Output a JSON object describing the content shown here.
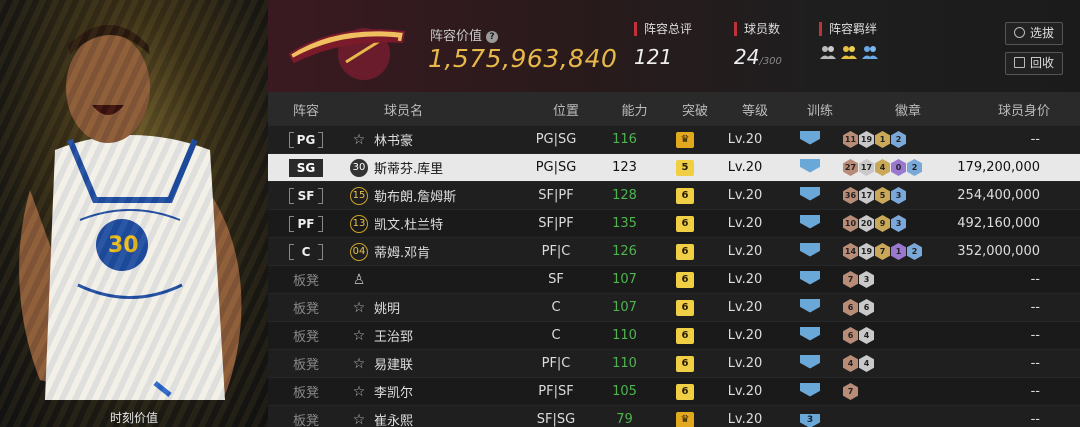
{
  "player_panel": {
    "label": "时刻价值"
  },
  "header": {
    "value_label": "阵容价值",
    "value": "1,575,963,840",
    "rating_label": "阵容总评",
    "rating": "121",
    "count_label": "球员数",
    "count": "24",
    "count_max": "/300",
    "bond_label": "阵容羁绊",
    "buttons": {
      "select": "选拔",
      "recycle": "回收"
    },
    "accent_color": "#c0313a",
    "value_color": "#e8b84a"
  },
  "columns": [
    "阵容",
    "球员名",
    "位置",
    "能力",
    "突破",
    "等级",
    "训练",
    "徽章",
    "球员身价"
  ],
  "rows": [
    {
      "slot": "PG",
      "jersey": "☆",
      "name": "林书豪",
      "pos": "PG|SG",
      "ability": "116",
      "break": "crown",
      "level": "Lv.20",
      "train": "",
      "badges": [
        [
          "11",
          "h1"
        ],
        [
          "19",
          "h2"
        ],
        [
          "1",
          "h3"
        ],
        [
          "2",
          "h4"
        ]
      ],
      "worth": "--",
      "sel": false,
      "bench": false
    },
    {
      "slot": "SG",
      "jersey": "30",
      "name": "斯蒂芬.库里",
      "pos": "PG|SG",
      "ability": "123",
      "break": "5",
      "level": "Lv.20",
      "train": "",
      "badges": [
        [
          "27",
          "h1"
        ],
        [
          "17",
          "h2"
        ],
        [
          "4",
          "h3"
        ],
        [
          "0",
          "h5"
        ],
        [
          "2",
          "h4"
        ]
      ],
      "worth": "179,200,000",
      "sel": true,
      "bench": false
    },
    {
      "slot": "SF",
      "jersey": "15",
      "name": "勒布朗.詹姆斯",
      "pos": "SF|PF",
      "ability": "128",
      "break": "6",
      "level": "Lv.20",
      "train": "",
      "badges": [
        [
          "36",
          "h1"
        ],
        [
          "17",
          "h2"
        ],
        [
          "5",
          "h3"
        ],
        [
          "3",
          "h4"
        ]
      ],
      "worth": "254,400,000",
      "sel": false,
      "bench": false
    },
    {
      "slot": "PF",
      "jersey": "13",
      "name": "凯文.杜兰特",
      "pos": "SF|PF",
      "ability": "135",
      "break": "6",
      "level": "Lv.20",
      "train": "",
      "badges": [
        [
          "10",
          "h1"
        ],
        [
          "20",
          "h2"
        ],
        [
          "9",
          "h3"
        ],
        [
          "3",
          "h4"
        ]
      ],
      "worth": "492,160,000",
      "sel": false,
      "bench": false
    },
    {
      "slot": "C",
      "jersey": "04",
      "name": "蒂姆.邓肯",
      "pos": "PF|C",
      "ability": "126",
      "break": "6",
      "level": "Lv.20",
      "train": "",
      "badges": [
        [
          "14",
          "h1"
        ],
        [
          "19",
          "h2"
        ],
        [
          "7",
          "h3"
        ],
        [
          "1",
          "h5"
        ],
        [
          "2",
          "h4"
        ]
      ],
      "worth": "352,000,000",
      "sel": false,
      "bench": false
    },
    {
      "slot": "板凳",
      "jersey": "♙",
      "name": "",
      "pos": "SF",
      "ability": "107",
      "break": "6",
      "level": "Lv.20",
      "train": "",
      "badges": [
        [
          "7",
          "h1"
        ],
        [
          "3",
          "h2"
        ]
      ],
      "worth": "--",
      "sel": false,
      "bench": true
    },
    {
      "slot": "板凳",
      "jersey": "☆",
      "name": "姚明",
      "pos": "C",
      "ability": "107",
      "break": "6",
      "level": "Lv.20",
      "train": "",
      "badges": [
        [
          "6",
          "h1"
        ],
        [
          "6",
          "h2"
        ]
      ],
      "worth": "--",
      "sel": false,
      "bench": true
    },
    {
      "slot": "板凳",
      "jersey": "☆",
      "name": "王治郅",
      "pos": "C",
      "ability": "110",
      "break": "6",
      "level": "Lv.20",
      "train": "",
      "badges": [
        [
          "6",
          "h1"
        ],
        [
          "4",
          "h2"
        ]
      ],
      "worth": "--",
      "sel": false,
      "bench": true
    },
    {
      "slot": "板凳",
      "jersey": "☆",
      "name": "易建联",
      "pos": "PF|C",
      "ability": "110",
      "break": "6",
      "level": "Lv.20",
      "train": "",
      "badges": [
        [
          "4",
          "h1"
        ],
        [
          "4",
          "h2"
        ]
      ],
      "worth": "--",
      "sel": false,
      "bench": true
    },
    {
      "slot": "板凳",
      "jersey": "☆",
      "name": "李凯尔",
      "pos": "PF|SF",
      "ability": "105",
      "break": "6",
      "level": "Lv.20",
      "train": "",
      "badges": [
        [
          "7",
          "h1"
        ]
      ],
      "worth": "--",
      "sel": false,
      "bench": true
    },
    {
      "slot": "板凳",
      "jersey": "☆",
      "name": "崔永熙",
      "pos": "SF|SG",
      "ability": "79",
      "break": "crown",
      "level": "Lv.20",
      "train": "3",
      "badges": [],
      "worth": "--",
      "sel": false,
      "bench": true
    }
  ]
}
